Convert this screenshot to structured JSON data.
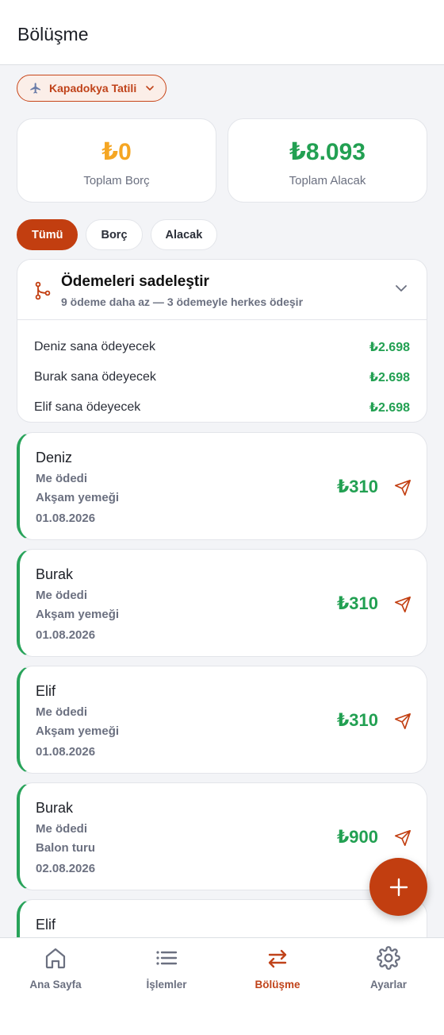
{
  "header": {
    "title": "Bölüşme"
  },
  "trip_selector": {
    "label": "Kapadokya Tatili",
    "icon": "airplane-icon"
  },
  "summary": {
    "debt": {
      "amount": "₺0",
      "label": "Toplam Borç",
      "color": "#f5a623"
    },
    "credit": {
      "amount": "₺8.093",
      "label": "Toplam Alacak",
      "color": "#22a052"
    }
  },
  "filters": [
    {
      "label": "Tümü",
      "active": true
    },
    {
      "label": "Borç",
      "active": false
    },
    {
      "label": "Alacak",
      "active": false
    }
  ],
  "simplify": {
    "title": "Ödemeleri sadeleştir",
    "subtitle": "9 ödeme daha az — 3 ödemeyle herkes ödeşir",
    "rows": [
      {
        "text": "Deniz sana ödeyecek",
        "amount": "₺2.698"
      },
      {
        "text": "Burak sana ödeyecek",
        "amount": "₺2.698"
      },
      {
        "text": "Elif sana ödeyecek",
        "amount": "₺2.698"
      }
    ]
  },
  "debts": [
    {
      "name": "Deniz",
      "payer": "Me ödedi",
      "desc": "Akşam yemeği",
      "date": "01.08.2026",
      "amount": "₺310"
    },
    {
      "name": "Burak",
      "payer": "Me ödedi",
      "desc": "Akşam yemeği",
      "date": "01.08.2026",
      "amount": "₺310"
    },
    {
      "name": "Elif",
      "payer": "Me ödedi",
      "desc": "Akşam yemeği",
      "date": "01.08.2026",
      "amount": "₺310"
    },
    {
      "name": "Burak",
      "payer": "Me ödedi",
      "desc": "Balon turu",
      "date": "02.08.2026",
      "amount": "₺900"
    },
    {
      "name": "Elif",
      "payer": "",
      "desc": "",
      "date": "",
      "amount": ""
    }
  ],
  "fab": {
    "icon": "plus-icon"
  },
  "nav": [
    {
      "label": "Ana Sayfa",
      "icon": "home-icon",
      "active": false
    },
    {
      "label": "İşlemler",
      "icon": "list-icon",
      "active": false
    },
    {
      "label": "Bölüşme",
      "icon": "swap-arrows-icon",
      "active": true
    },
    {
      "label": "Ayarlar",
      "icon": "gear-icon",
      "active": false
    }
  ],
  "colors": {
    "accent": "#c23e10",
    "positive": "#22a052",
    "warning": "#f5a623"
  }
}
